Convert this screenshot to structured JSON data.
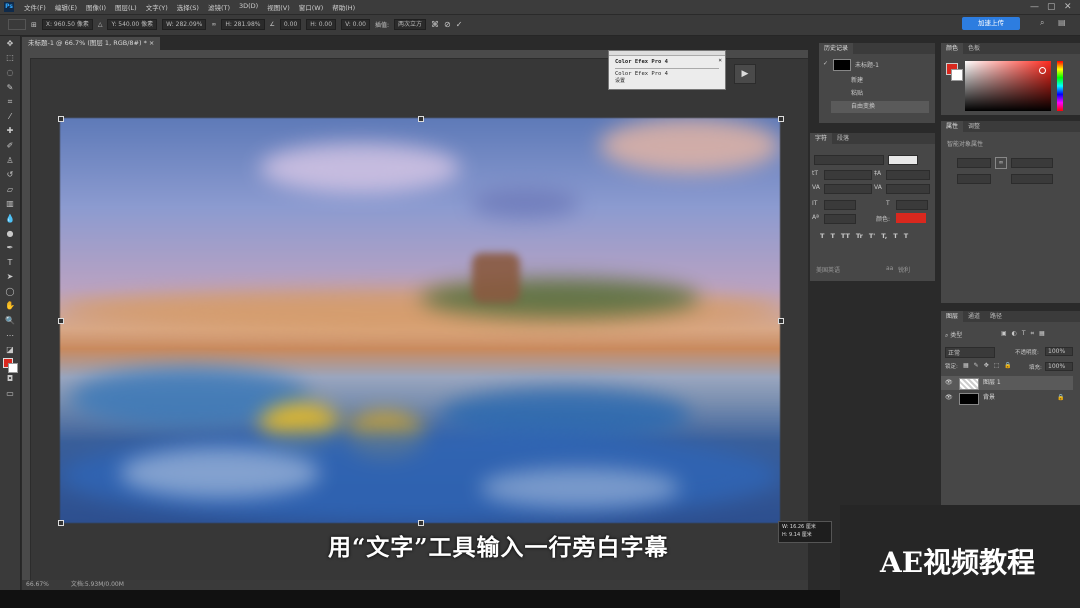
{
  "app": {
    "logo": "Ps"
  },
  "menu": [
    "文件(F)",
    "编辑(E)",
    "图像(I)",
    "图层(L)",
    "文字(Y)",
    "选择(S)",
    "滤镜(T)",
    "3D(D)",
    "视图(V)",
    "窗口(W)",
    "帮助(H)"
  ],
  "window_controls": {
    "minimize": "—",
    "restore": "▢",
    "close": "✕"
  },
  "options": {
    "x_value": "X: 960.50 像素",
    "y_value": "Y: 540.00 像素",
    "w_value": "W: 282.09%",
    "h_value": "H: 281.98%",
    "angle_value": "0.00",
    "hskew_value": "H: 0.00",
    "vskew_value": "V: 0.00",
    "interpolation_label": "插值:",
    "interpolation_value": "两次立方"
  },
  "cloud_button": "加速上传",
  "document_tab": "未标题-1 @ 66.7% (图层 1, RGB/8#) *",
  "filter_popup": {
    "title": "Color Efex Pro 4",
    "line2": "Color Efex Pro 4",
    "line3": "设置"
  },
  "play_icon": "▶",
  "subtitle": "用“文字”工具输入一行旁白字幕",
  "size_readout": {
    "w": "W: 16.26 厘米",
    "h": "H:  9.14 厘米"
  },
  "status": {
    "zoom": "66.67%",
    "doc": "文档:5.93M/0.00M"
  },
  "history": {
    "tabs": [
      "历史记录"
    ],
    "snapshot": "未标题-1",
    "items": [
      "新建",
      "粘贴",
      "自由变换"
    ]
  },
  "character": {
    "tabs": [
      "字符",
      "段落"
    ],
    "color_label": "颜色:",
    "color": "#d9281e",
    "style_buttons": [
      "T",
      "T",
      "TT",
      "Tr",
      "T'",
      "T,",
      "T",
      "T"
    ],
    "lang": "美国英语",
    "aa": "aa",
    "aa_value": "锐利"
  },
  "color_panel": {
    "tabs": [
      "颜色",
      "色板"
    ],
    "fg": "#d9281e",
    "bg": "#ffffff"
  },
  "properties": {
    "tabs": [
      "属性",
      "调整"
    ],
    "title": "智能对象属性"
  },
  "layers": {
    "tabs": [
      "图层",
      "通道",
      "路径"
    ],
    "kind": "类型",
    "blend": "正常",
    "opacity_label": "不透明度:",
    "opacity": "100%",
    "lock_label": "锁定:",
    "fill_label": "填充:",
    "fill": "100%",
    "rows": [
      {
        "name": "图层 1"
      },
      {
        "name": "背景"
      }
    ]
  },
  "watermark": "AE视频教程"
}
